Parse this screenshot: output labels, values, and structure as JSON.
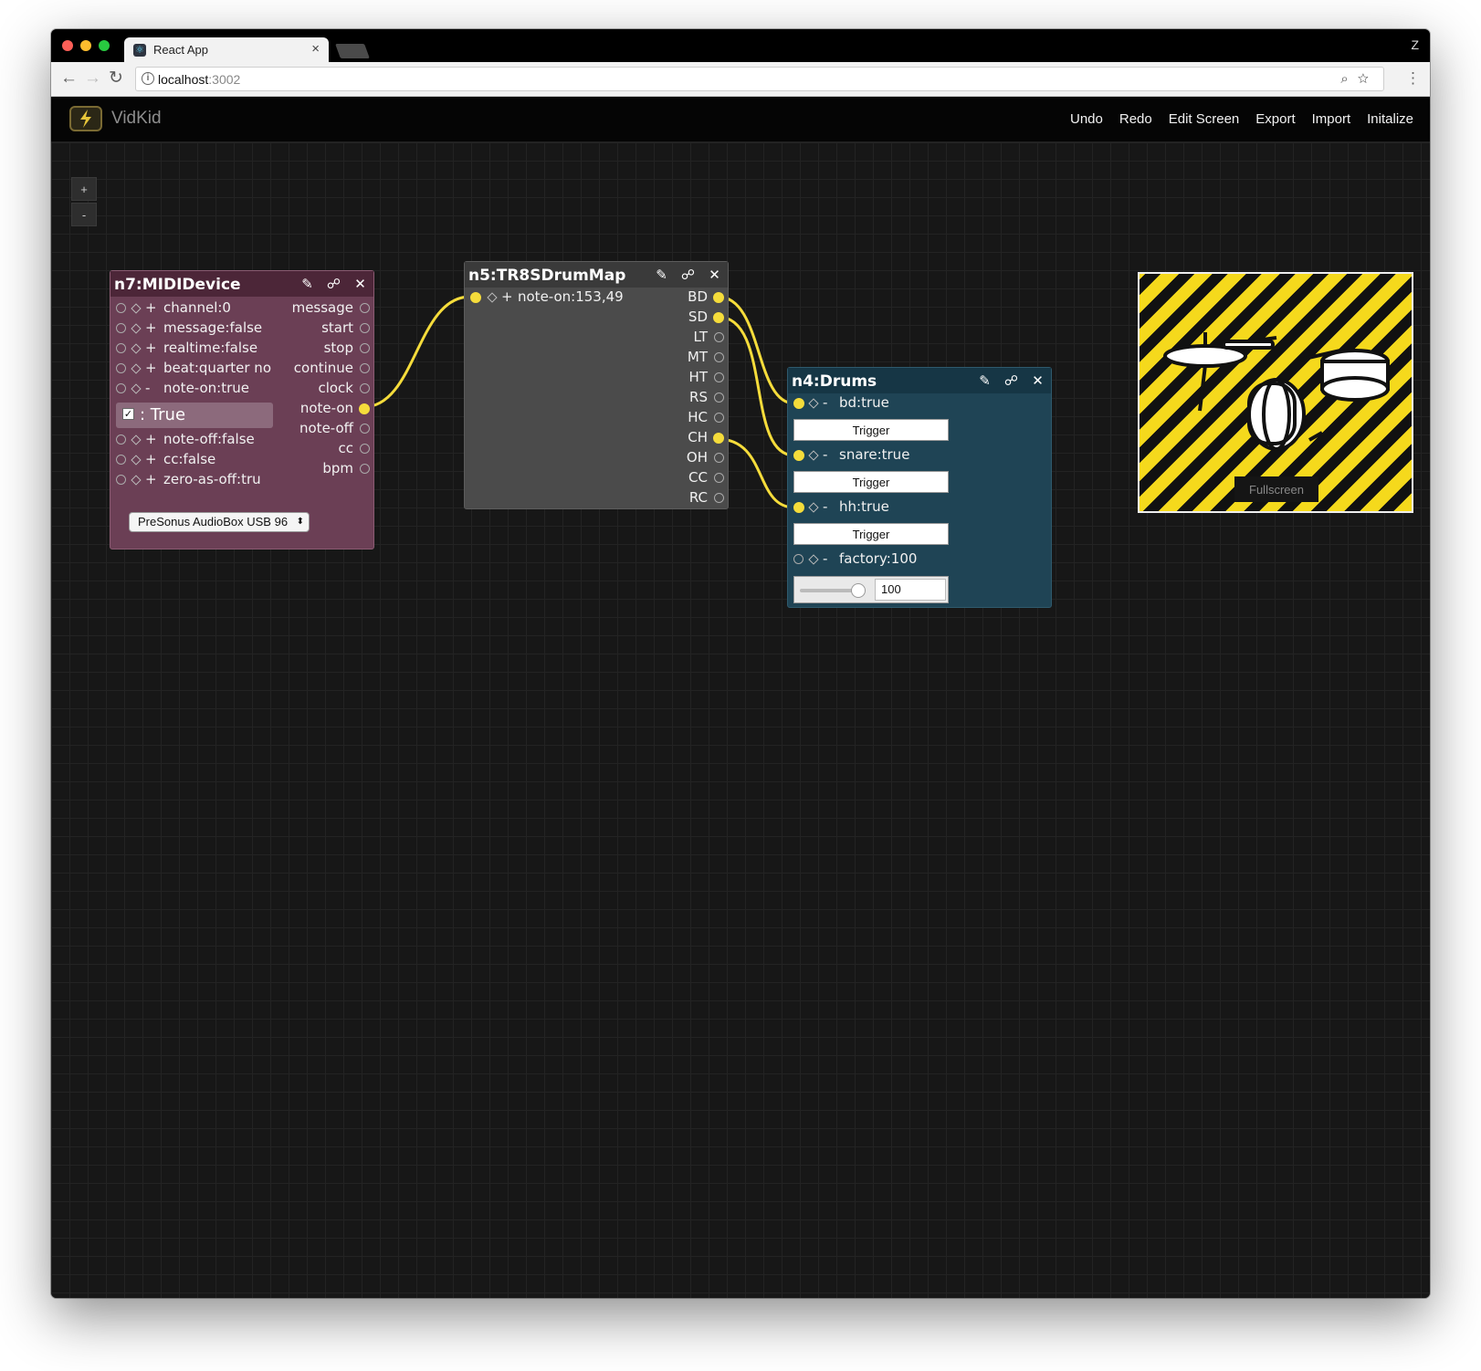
{
  "browser": {
    "tab_title": "React App",
    "tab_close": "×",
    "profile": "Z",
    "url_host": "localhost",
    "url_port": ":3002"
  },
  "app": {
    "title": "VidKid",
    "menu": [
      "Undo",
      "Redo",
      "Edit Screen",
      "Export",
      "Import",
      "Initalize"
    ],
    "zoom_in": "+",
    "zoom_out": "-"
  },
  "nodes": {
    "midi": {
      "title": "n7:MIDIDevice",
      "bg": "#6b3f55",
      "inputs": [
        {
          "sign": "+",
          "label": "channel:0"
        },
        {
          "sign": "+",
          "label": "message:false"
        },
        {
          "sign": "+",
          "label": "realtime:false"
        },
        {
          "sign": "+",
          "label": "beat:quarter no"
        },
        {
          "sign": "-",
          "label": "note-on:true"
        },
        {
          "sign": "+",
          "label": "note-off:false"
        },
        {
          "sign": "+",
          "label": "cc:false"
        },
        {
          "sign": "+",
          "label": "zero-as-off:tru"
        }
      ],
      "checkbox_label": ": True",
      "outputs": [
        "message",
        "start",
        "stop",
        "continue",
        "clock",
        "note-on",
        "note-off",
        "cc",
        "bpm"
      ],
      "device": "PreSonus AudioBox USB 96"
    },
    "drummap": {
      "title": "n5:TR8SDrumMap",
      "bg": "#4b4b4b",
      "input": "note-on:153,49",
      "input_sign": "+",
      "outputs": [
        "BD",
        "SD",
        "LT",
        "MT",
        "HT",
        "RS",
        "HC",
        "CH",
        "OH",
        "CC",
        "RC"
      ],
      "active_outputs": [
        "BD",
        "SD",
        "CH"
      ]
    },
    "drums": {
      "title": "n4:Drums",
      "bg": "#1f4455",
      "inputs": [
        {
          "label": "bd:true",
          "connected": true,
          "control": "Trigger"
        },
        {
          "label": "snare:true",
          "connected": true,
          "control": "Trigger"
        },
        {
          "label": "hh:true",
          "connected": true,
          "control": "Trigger"
        },
        {
          "label": "factory:100",
          "connected": false,
          "control": "slider"
        }
      ],
      "sign": "-",
      "factory_value": "100",
      "factory_level": 1.0
    }
  },
  "preview": {
    "fullscreen_label": "Fullscreen",
    "accent": "#f5d91c"
  },
  "wire_color": "#f5dc3b"
}
